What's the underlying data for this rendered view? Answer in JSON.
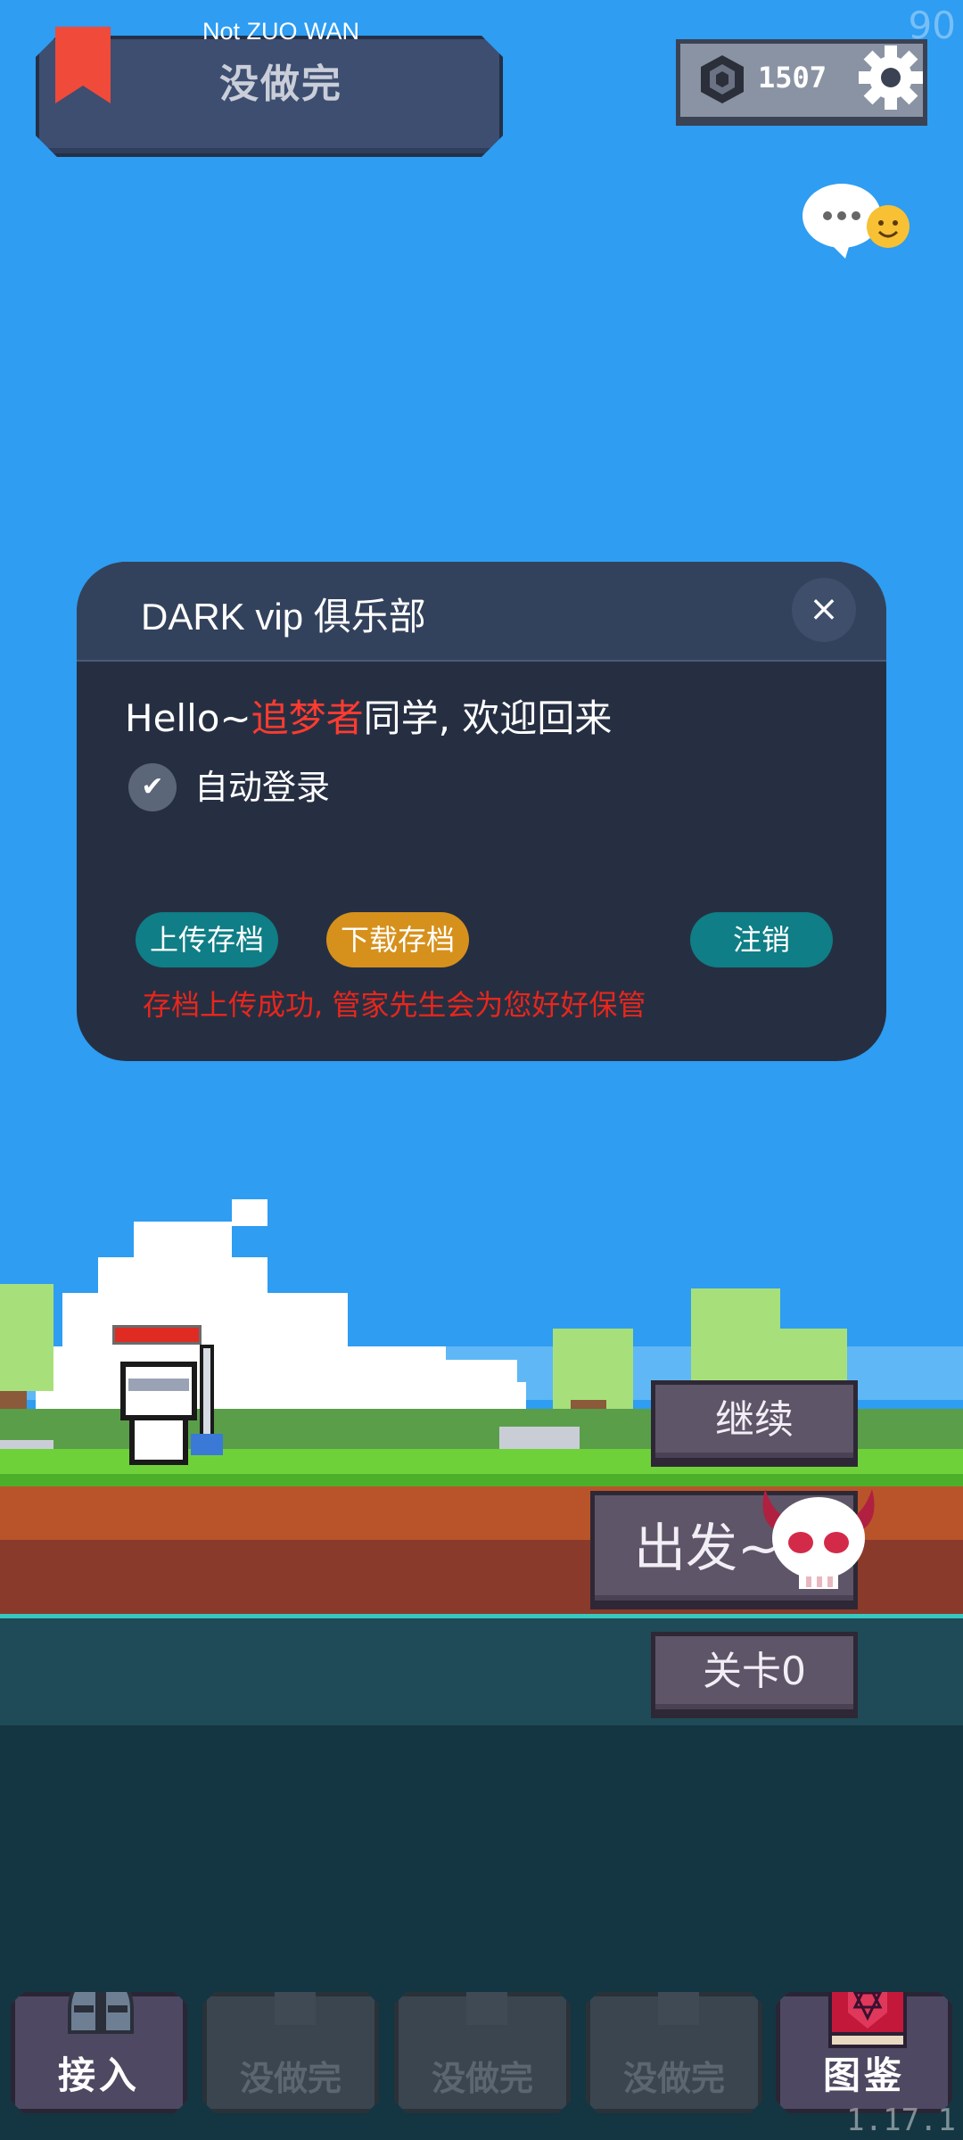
{
  "status_bar": {
    "fps": "90",
    "version": "1.17.1"
  },
  "profile": {
    "name": "Not ZUO WAN",
    "status": "没做完"
  },
  "currency": {
    "value": "1507"
  },
  "dialog": {
    "title": "DARK vip 俱乐部",
    "close_symbol": "×",
    "greeting_prefix": "Hello~",
    "greeting_name": "追梦者",
    "greeting_suffix": "同学, 欢迎回来",
    "auto_login_label": "自动登录",
    "auto_login_checked": true,
    "upload_label": "上传存档",
    "download_label": "下载存档",
    "logout_label": "注销",
    "status_message": "存档上传成功, 管家先生会为您好好保管"
  },
  "game": {
    "continue_label": "继续",
    "start_label": "出发~",
    "level_label": "关卡0",
    "hero_hp_fraction": 1.0
  },
  "nav": [
    {
      "label": "接入",
      "locked": false,
      "icon": "knight-helmet-icon"
    },
    {
      "label": "没做完",
      "locked": true,
      "icon": "lock-icon"
    },
    {
      "label": "没做完",
      "locked": true,
      "icon": "lock-icon"
    },
    {
      "label": "没做完",
      "locked": true,
      "icon": "lock-icon"
    },
    {
      "label": "图鉴",
      "locked": false,
      "icon": "codex-book-icon"
    }
  ],
  "colors": {
    "sky": "#2e9df2",
    "accent_red": "#ff3b30",
    "teal_button": "#0f7e86",
    "orange_button": "#d6911c"
  }
}
